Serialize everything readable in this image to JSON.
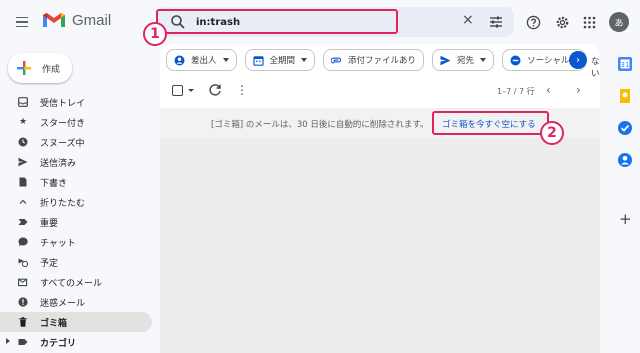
{
  "header": {
    "app_name": "Gmail",
    "search_value": "in:trash",
    "clear_icon": "×",
    "avatar_letter": "あ"
  },
  "annotations": {
    "step1": "1",
    "step2": "2",
    "highlight_color": "#e0245e"
  },
  "compose": {
    "label": "作成"
  },
  "sidebar": {
    "items": [
      {
        "label": "受信トレイ",
        "icon": "inbox-icon"
      },
      {
        "label": "スター付き",
        "icon": "star-icon"
      },
      {
        "label": "スヌーズ中",
        "icon": "clock-icon"
      },
      {
        "label": "送信済み",
        "icon": "send-icon"
      },
      {
        "label": "下書き",
        "icon": "draft-icon"
      },
      {
        "label": "折りたたむ",
        "icon": "chevron-up-icon"
      },
      {
        "label": "重要",
        "icon": "label-important-icon"
      },
      {
        "label": "チャット",
        "icon": "chat-icon"
      },
      {
        "label": "予定",
        "icon": "scheduled-icon"
      },
      {
        "label": "すべてのメール",
        "icon": "all-mail-icon"
      },
      {
        "label": "迷惑メール",
        "icon": "spam-icon"
      },
      {
        "label": "ゴミ箱",
        "icon": "trash-icon",
        "active": true
      },
      {
        "label": "カテゴリ",
        "icon": "label-icon"
      }
    ]
  },
  "filters": {
    "chips": [
      {
        "label": "差出人",
        "icon": "person-icon"
      },
      {
        "label": "全期間",
        "icon": "calendar-icon"
      },
      {
        "label": "添付ファイルあり",
        "icon": "attachment-icon"
      },
      {
        "label": "宛先",
        "icon": "send-icon"
      },
      {
        "label": "ソーシャル",
        "icon": "minus-circle-icon"
      }
    ],
    "overflow_text": "ない"
  },
  "toolbar": {
    "count": "1–7 / 7 行",
    "more": "⋮",
    "prev": "‹",
    "next": "›"
  },
  "trash_notice": {
    "text": "[ゴミ箱] のメールは、30 日後に自動的に削除されます。",
    "empty_link": "ゴミ箱を今すぐ空にする"
  },
  "colors": {
    "accent": "#0b57d0",
    "active_nav": "#e1e3e1",
    "background": "#f6f8fc"
  }
}
